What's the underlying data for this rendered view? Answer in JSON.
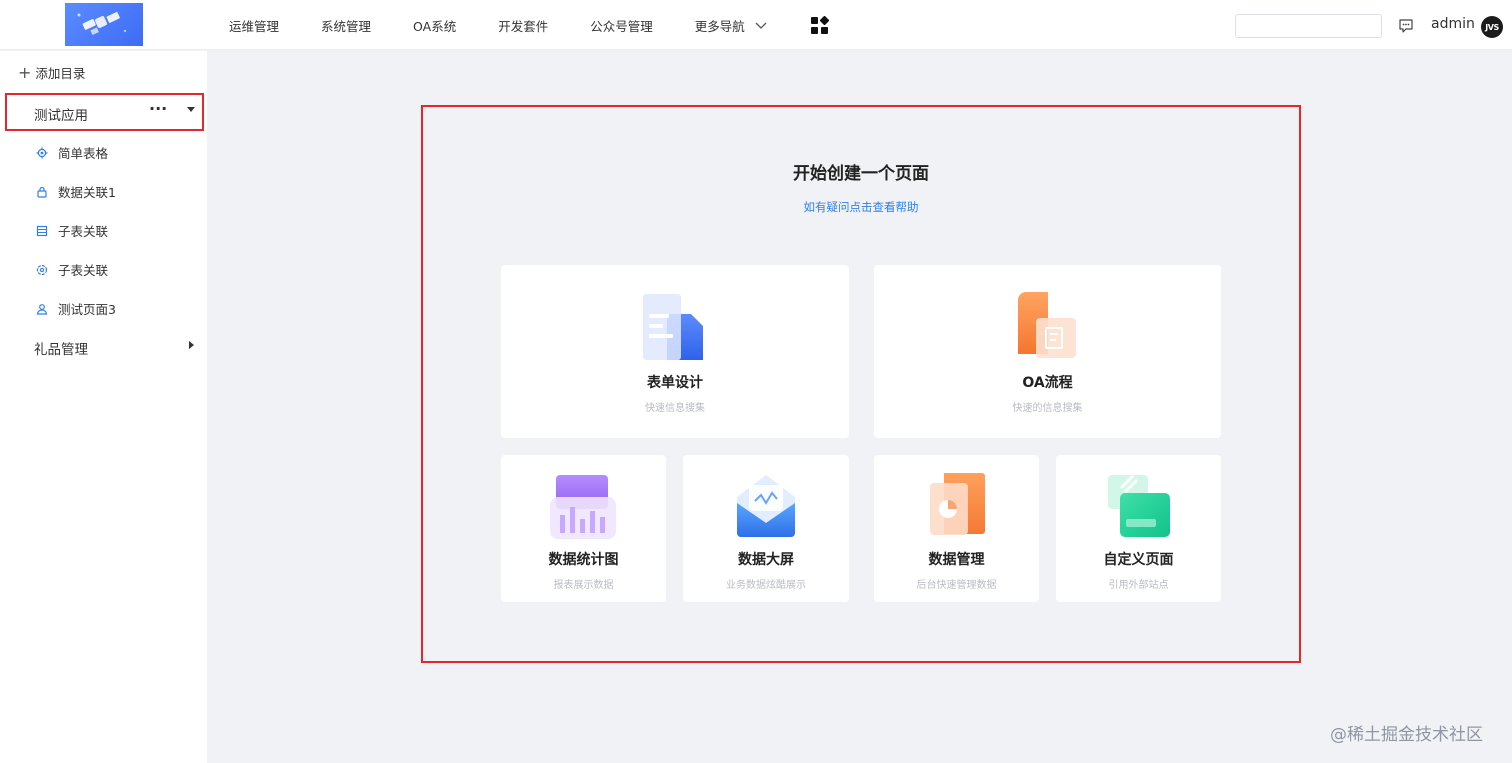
{
  "header": {
    "nav": [
      "运维管理",
      "系统管理",
      "OA系统",
      "开发套件",
      "公众号管理",
      "更多导航"
    ],
    "search": {
      "value": "",
      "placeholder": ""
    },
    "user": "admin",
    "avatar_text": "JVS"
  },
  "sidebar": {
    "add_dir": "添加目录",
    "app": {
      "label": "测试应用",
      "more": "···"
    },
    "items": [
      {
        "label": "简单表格",
        "icon": "gear-icon"
      },
      {
        "label": "数据关联1",
        "icon": "lock-icon"
      },
      {
        "label": "子表关联",
        "icon": "table-icon"
      },
      {
        "label": "子表关联",
        "icon": "settings-circle-icon"
      },
      {
        "label": "测试页面3",
        "icon": "user-icon"
      }
    ],
    "group": "礼品管理"
  },
  "main": {
    "title": "开始创建一个页面",
    "help": "如有疑问点击查看帮助",
    "cards": [
      {
        "title": "表单设计",
        "desc": "快速信息搜集"
      },
      {
        "title": "OA流程",
        "desc": "快速的信息搜集"
      },
      {
        "title": "数据统计图",
        "desc": "报表展示数据"
      },
      {
        "title": "数据大屏",
        "desc": "业务数据炫酷展示"
      },
      {
        "title": "数据管理",
        "desc": "后台快速管理数据"
      },
      {
        "title": "自定义页面",
        "desc": "引用外部站点"
      }
    ]
  },
  "watermark": "@稀土掘金技术社区",
  "colors": {
    "accent": "#2f80ed",
    "highlight_border": "#e5262a",
    "background": "#f0f2f6"
  }
}
